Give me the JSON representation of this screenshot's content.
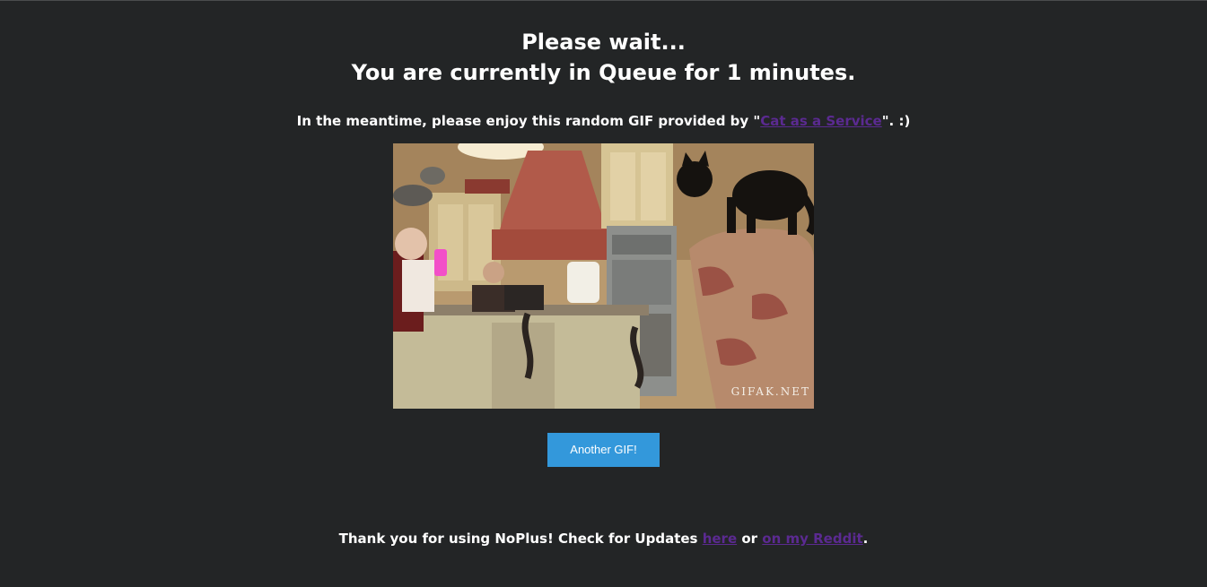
{
  "header": {
    "line1": "Please wait...",
    "line2": "You are currently in Queue for 1 minutes."
  },
  "subtitle": {
    "prefix": "In the meantime, please enjoy this random GIF provided by \"",
    "link_label": "Cat as a Service",
    "suffix": "\". :)"
  },
  "gif": {
    "watermark": "GIFAK.NET"
  },
  "button": {
    "label": "Another GIF!"
  },
  "footer": {
    "prefix": "Thank you for using NoPlus! Check for Updates ",
    "here_label": "here",
    "middle": " or ",
    "reddit_label": "on my Reddit",
    "suffix": "."
  },
  "colors": {
    "background": "#232526",
    "button": "#3398db",
    "link": "#5b2a91"
  }
}
